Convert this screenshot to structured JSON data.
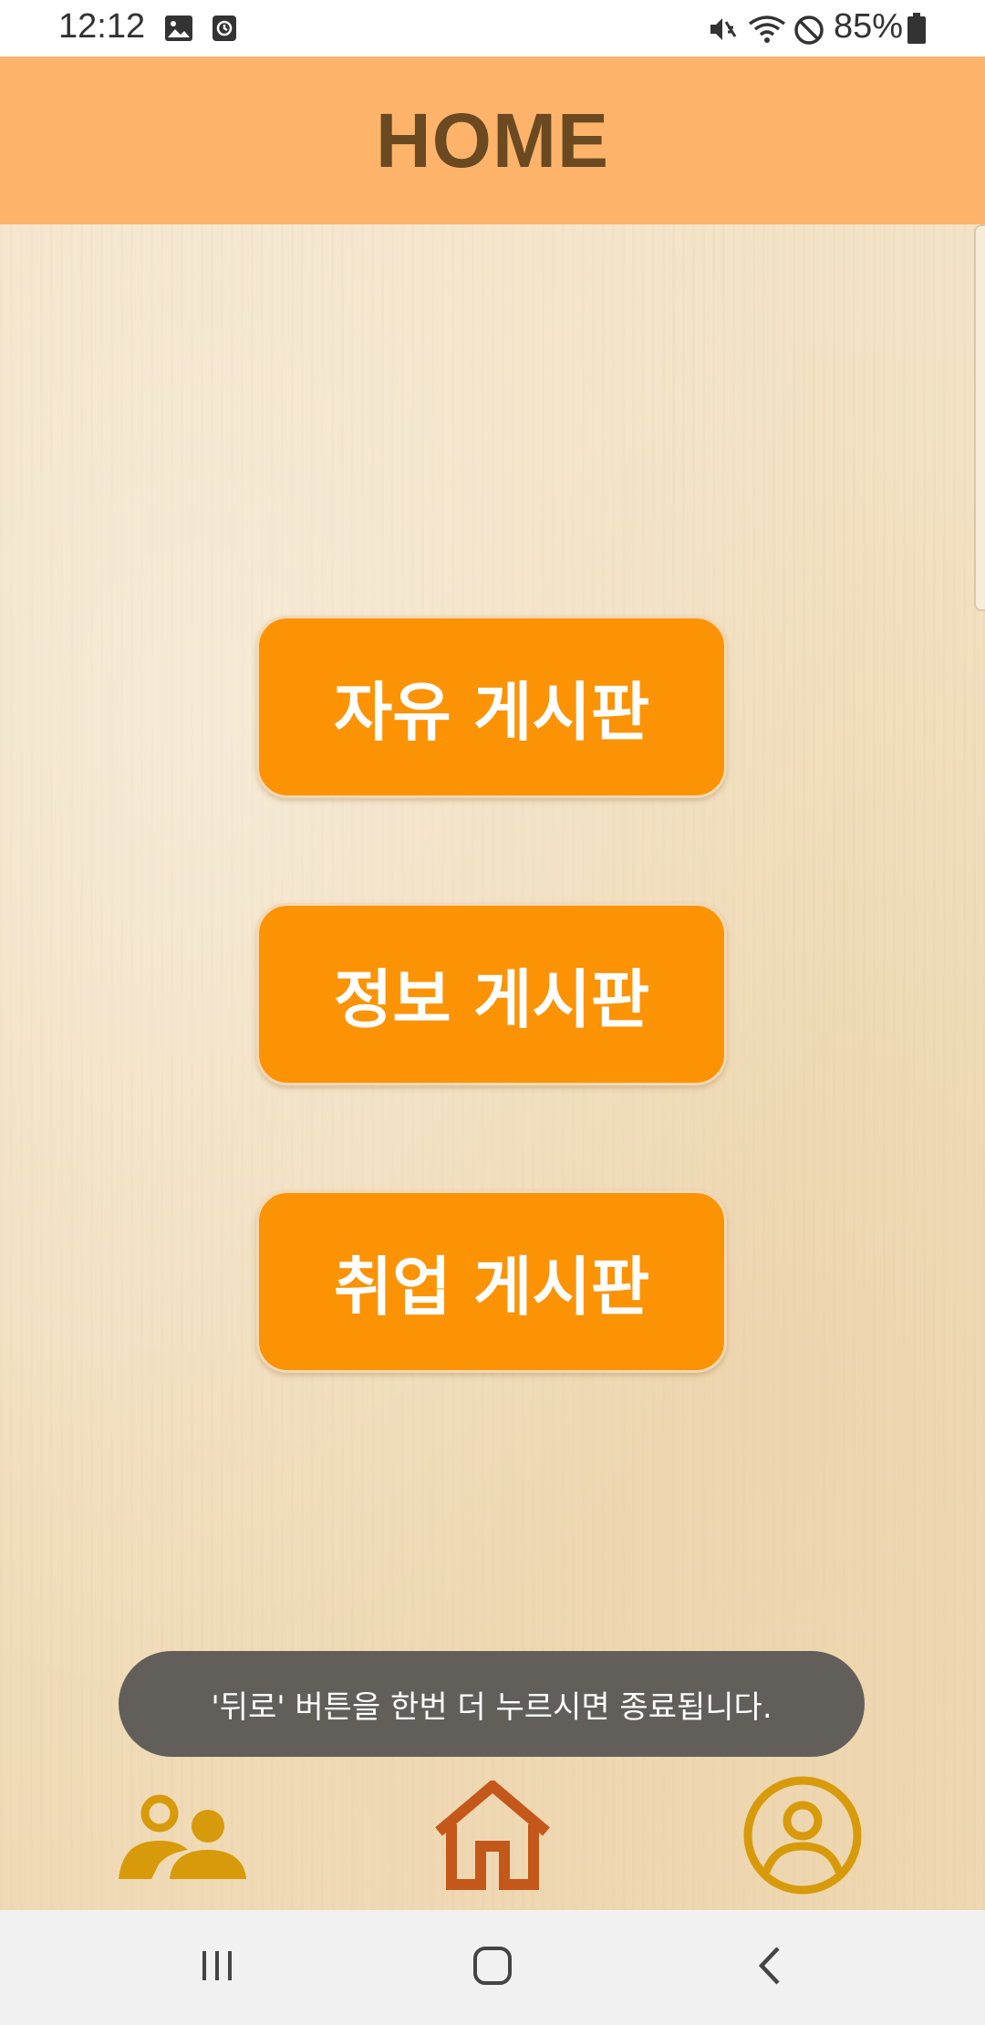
{
  "status_bar": {
    "time": "12:12",
    "battery": "85%",
    "icons": [
      "image-icon",
      "alarm-icon",
      "mute-icon",
      "wifi-icon",
      "block-icon",
      "battery-icon"
    ]
  },
  "app_bar": {
    "title": "HOME"
  },
  "boards": [
    {
      "label": "자유 게시판"
    },
    {
      "label": "정보 게시판"
    },
    {
      "label": "취업 게시판"
    }
  ],
  "toast": {
    "message": "'뒤로' 버튼을 한번 더 누르시면 종료됩니다."
  },
  "bottom_nav": {
    "items": [
      "people-icon",
      "home-icon",
      "profile-icon"
    ],
    "colors": {
      "people": "#d79a0a",
      "home": "#c4571a",
      "profile": "#d79a0a"
    }
  },
  "system_nav": {
    "items": [
      "recents-icon",
      "home-button-icon",
      "back-icon"
    ]
  },
  "colors": {
    "app_bar": "#fdb46a",
    "title": "#6b4a22",
    "button": "#fc9305",
    "toast": "#625f5b"
  }
}
